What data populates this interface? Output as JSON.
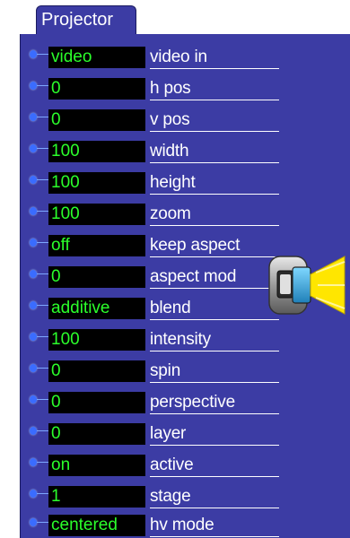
{
  "actor": {
    "title": "Projector",
    "icon": "projector-icon",
    "colors": {
      "panel": "#3c3ca4",
      "value_text": "#2bff2b",
      "value_bg": "#000000",
      "dot": "#3a6cff"
    }
  },
  "properties": [
    {
      "value": "video",
      "label": "video in"
    },
    {
      "value": "0",
      "label": "h pos"
    },
    {
      "value": "0",
      "label": "v pos"
    },
    {
      "value": "100",
      "label": "width"
    },
    {
      "value": "100",
      "label": "height"
    },
    {
      "value": "100",
      "label": "zoom"
    },
    {
      "value": "off",
      "label": "keep aspect"
    },
    {
      "value": "0",
      "label": "aspect mod"
    },
    {
      "value": "additive",
      "label": "blend"
    },
    {
      "value": "100",
      "label": "intensity"
    },
    {
      "value": "0",
      "label": "spin"
    },
    {
      "value": "0",
      "label": "perspective"
    },
    {
      "value": "0",
      "label": "layer"
    },
    {
      "value": "on",
      "label": "active"
    },
    {
      "value": "1",
      "label": "stage"
    },
    {
      "value": "centered",
      "label": "hv mode"
    }
  ]
}
